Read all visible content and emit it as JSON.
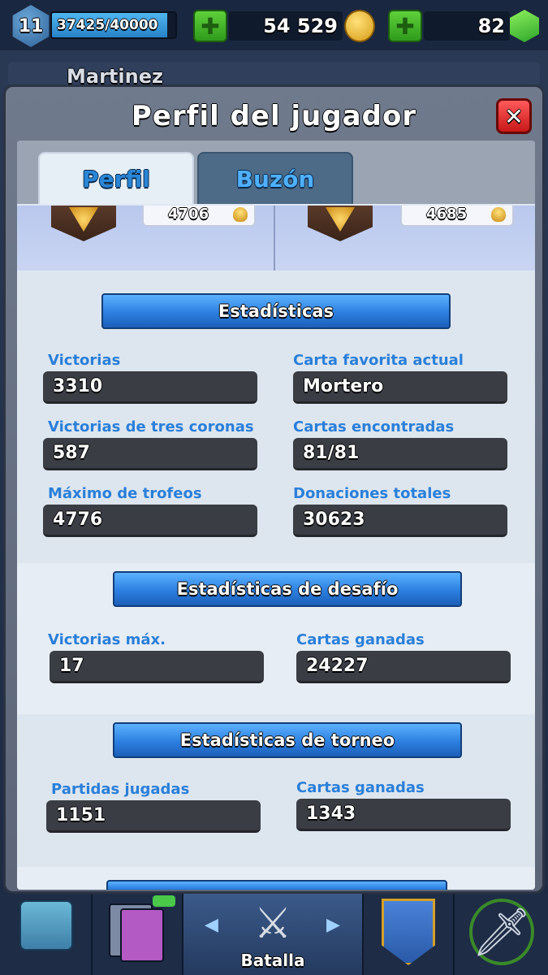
{
  "topbar": {
    "level": "11",
    "xp": "37425/40000",
    "xp_fraction": 0.936,
    "gold": "54 529",
    "gems": "82"
  },
  "background": {
    "player_name": "Martinez"
  },
  "modal": {
    "title": "Perfil del jugador",
    "close_label": "✕",
    "tabs": [
      {
        "label": "Perfil",
        "active": true
      },
      {
        "label": "Buzón",
        "active": false
      }
    ],
    "arena": {
      "left_trophies": "4706",
      "right_trophies": "4685"
    },
    "sections": {
      "stats": {
        "title": "Estadísticas",
        "items": [
          {
            "label": "Victorias",
            "value": "3310"
          },
          {
            "label": "Carta favorita actual",
            "value": "Mortero"
          },
          {
            "label": "Victorias de tres coronas",
            "value": "587"
          },
          {
            "label": "Cartas encontradas",
            "value": "81/81"
          },
          {
            "label": "Máximo de trofeos",
            "value": "4776"
          },
          {
            "label": "Donaciones totales",
            "value": "30623"
          }
        ]
      },
      "challenge": {
        "title": "Estadísticas de desafío",
        "items": [
          {
            "label": "Victorias máx.",
            "value": "17"
          },
          {
            "label": "Cartas ganadas",
            "value": "24227"
          }
        ]
      },
      "tournament": {
        "title": "Estadísticas de torneo",
        "items": [
          {
            "label": "Partidas jugadas",
            "value": "1151"
          },
          {
            "label": "Cartas ganadas",
            "value": "1343"
          }
        ]
      }
    }
  },
  "bottom_nav": {
    "battle_label": "Batalla",
    "left_arrow": "◀",
    "right_arrow": "▶",
    "swords_glyph": "⚔",
    "sword_glyph": "🗡"
  },
  "colors": {
    "accent_blue": "#2a7fd9",
    "ribbon_blue": "#2c7fe0",
    "value_box": "#3a3d44",
    "close_red": "#e02a2a",
    "plus_green": "#3fb52a"
  },
  "icons": [
    "level-badge-icon",
    "plus-icon",
    "coin-icon",
    "gem-icon",
    "close-icon",
    "trophy-icon",
    "chest-icon",
    "cards-icon",
    "swords-icon",
    "clan-icon",
    "sword-icon"
  ]
}
